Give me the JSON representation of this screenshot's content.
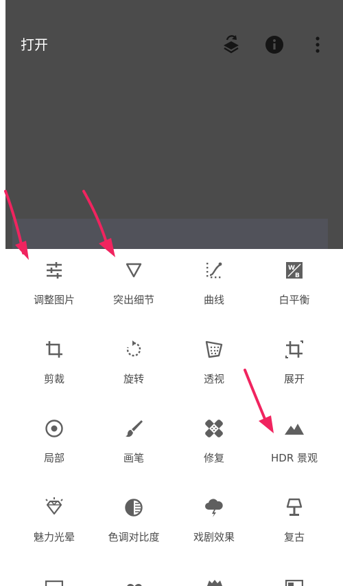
{
  "header": {
    "title": "打开",
    "actions": [
      {
        "name": "layers-undo-icon"
      },
      {
        "name": "info-icon"
      },
      {
        "name": "more-vert-icon"
      }
    ]
  },
  "tools": [
    {
      "label": "调整图片",
      "icon": "tune-sliders-icon"
    },
    {
      "label": "突出细节",
      "icon": "triangle-detail-icon"
    },
    {
      "label": "曲线",
      "icon": "curves-icon"
    },
    {
      "label": "白平衡",
      "icon": "white-balance-icon"
    },
    {
      "label": "剪裁",
      "icon": "crop-icon"
    },
    {
      "label": "旋转",
      "icon": "rotate-icon"
    },
    {
      "label": "透视",
      "icon": "perspective-icon"
    },
    {
      "label": "展开",
      "icon": "expand-icon"
    },
    {
      "label": "局部",
      "icon": "selective-icon"
    },
    {
      "label": "画笔",
      "icon": "brush-icon"
    },
    {
      "label": "修复",
      "icon": "healing-bandage-icon"
    },
    {
      "label": "HDR 景观",
      "icon": "hdr-mountain-icon"
    },
    {
      "label": "魅力光晕",
      "icon": "glamour-glow-icon"
    },
    {
      "label": "色调对比度",
      "icon": "tonal-contrast-icon"
    },
    {
      "label": "戏剧效果",
      "icon": "drama-cloud-icon"
    },
    {
      "label": "复古",
      "icon": "vintage-lamp-icon"
    }
  ],
  "colors": {
    "header_bg": "#4b4b4b",
    "icon": "#5f5f5f",
    "label": "#4a4a4a",
    "arrow": "#f0245f"
  }
}
